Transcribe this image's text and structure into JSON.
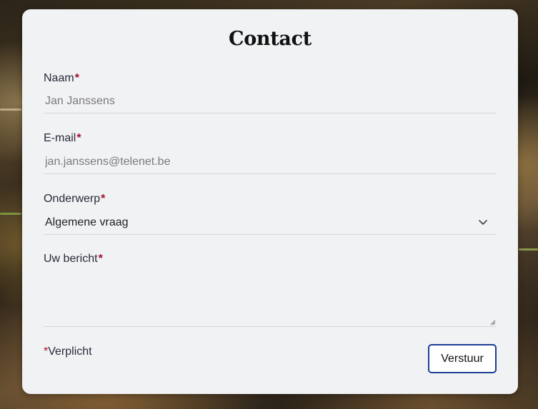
{
  "form": {
    "title": "Contact",
    "name": {
      "label": "Naam",
      "required_mark": "*",
      "placeholder": "Jan Janssens"
    },
    "email": {
      "label": "E-mail",
      "required_mark": "*",
      "placeholder": "jan.janssens@telenet.be"
    },
    "subject": {
      "label": "Onderwerp",
      "required_mark": "*",
      "selected": "Algemene vraag",
      "icon": "chevron-down-icon"
    },
    "message": {
      "label": "Uw bericht",
      "required_mark": "*"
    },
    "required_note": {
      "mark": "*",
      "text": "Verplicht"
    },
    "submit_label": "Verstuur"
  },
  "colors": {
    "required": "#a3102c",
    "button_border": "#1c3f94",
    "card_background": "#f1f2f4"
  }
}
